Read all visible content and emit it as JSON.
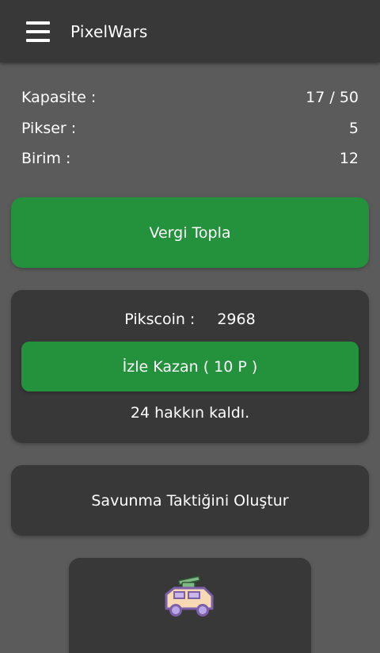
{
  "app": {
    "title": "PixelWars"
  },
  "stats": [
    {
      "label": "Kapasite :",
      "value": "17 / 50"
    },
    {
      "label": "Pikser :",
      "value": "5"
    },
    {
      "label": "Birim :",
      "value": "12"
    }
  ],
  "actions": {
    "collect_tax": "Vergi Topla",
    "create_defense": "Savunma Taktiğini Oluştur"
  },
  "coins": {
    "label": "Pikscoin :",
    "value": "2968",
    "watch_earn": "İzle Kazan ( 10 P )",
    "remaining": "24 hakkın kaldı."
  },
  "unit": {
    "icon": "armored-vehicle-icon"
  },
  "colors": {
    "accent_green": "#24913c",
    "card_bg": "#383838",
    "page_bg": "#5b5b5b"
  }
}
